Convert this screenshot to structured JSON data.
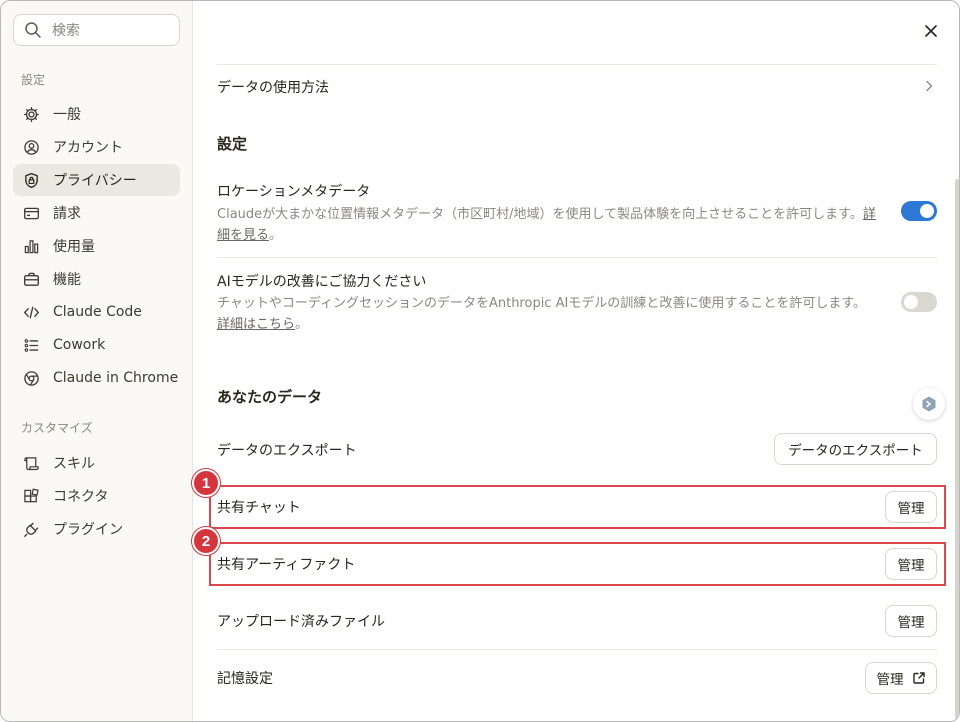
{
  "sidebar": {
    "search_placeholder": "検索",
    "section_settings": "設定",
    "items": [
      {
        "label": "一般",
        "icon": "gear-icon"
      },
      {
        "label": "アカウント",
        "icon": "user-circle-icon"
      },
      {
        "label": "プライバシー",
        "icon": "shield-lock-icon",
        "active": true
      },
      {
        "label": "請求",
        "icon": "credit-card-icon"
      },
      {
        "label": "使用量",
        "icon": "bar-chart-icon"
      },
      {
        "label": "機能",
        "icon": "toolbox-icon"
      },
      {
        "label": "Claude Code",
        "icon": "code-icon"
      },
      {
        "label": "Cowork",
        "icon": "checklist-icon"
      },
      {
        "label": "Claude in Chrome",
        "icon": "globe-icon"
      }
    ],
    "section_customize": "カスタマイズ",
    "customize_items": [
      {
        "label": "スキル",
        "icon": "scroll-icon"
      },
      {
        "label": "コネクタ",
        "icon": "blocks-icon"
      },
      {
        "label": "プラグイン",
        "icon": "plug-icon"
      }
    ]
  },
  "main": {
    "data_usage": "データの使用方法",
    "settings_heading": "設定",
    "location": {
      "title": "ロケーションメタデータ",
      "desc": "Claudeが大まかな位置情報メタデータ（市区町村/地域）を使用して製品体験を向上させることを許可します。",
      "link": "詳細を見る",
      "suffix": "。",
      "enabled": true
    },
    "model_improve": {
      "title": "AIモデルの改善にご協力ください",
      "desc": "チャットやコーディングセッションのデータをAnthropic AIモデルの訓練と改善に使用することを許可します。",
      "link": "詳細はこちら",
      "suffix": "。",
      "enabled": false
    },
    "your_data_heading": "あなたのデータ",
    "export": {
      "title": "データのエクスポート",
      "button": "データのエクスポート"
    },
    "shared_chats": {
      "title": "共有チャット",
      "button": "管理"
    },
    "shared_artifacts": {
      "title": "共有アーティファクト",
      "button": "管理"
    },
    "uploaded_files": {
      "title": "アップロード済みファイル",
      "button": "管理"
    },
    "memory": {
      "title": "記憶設定",
      "button": "管理"
    }
  },
  "annotations": {
    "badge1": "1",
    "badge2": "2",
    "color": "#d9484f"
  },
  "colors": {
    "accent": "#2c78d4",
    "sidebar_bg": "#faf9f5",
    "active_bg": "#eae8e0"
  }
}
